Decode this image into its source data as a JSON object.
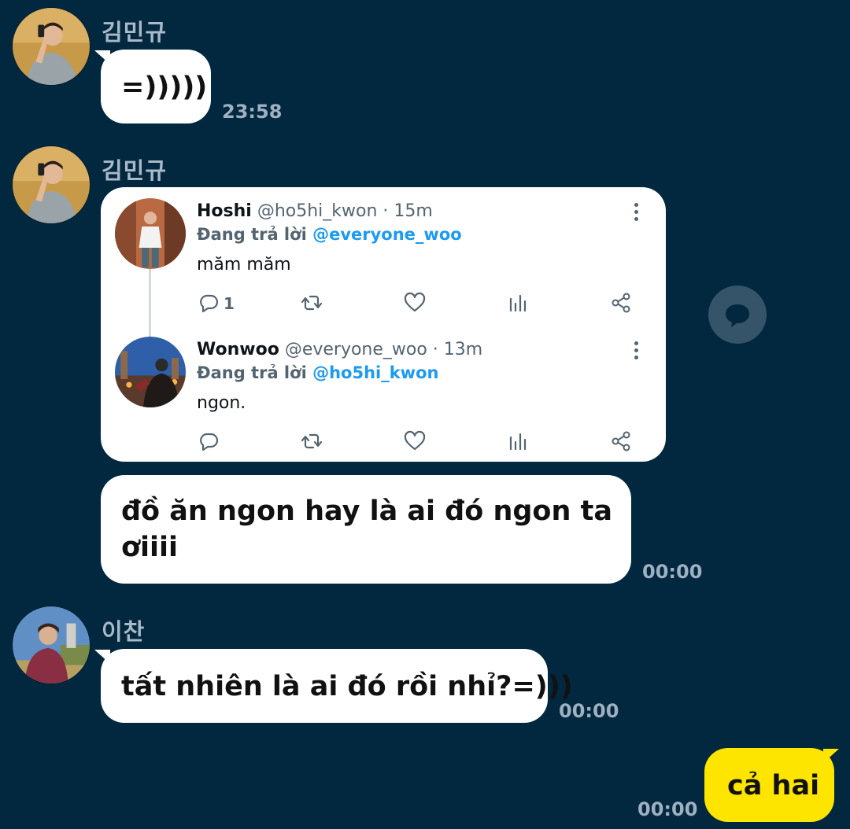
{
  "colors": {
    "background": "#022840",
    "bubble_incoming": "#ffffff",
    "bubble_outgoing": "#fee500",
    "link": "#1d9bf0",
    "name_text": "#a9b9c8",
    "time_text": "#9fb0c0"
  },
  "messages": [
    {
      "sender": "김민규",
      "text": "=)))))",
      "time": "23:58"
    },
    {
      "sender": "김민규",
      "shared_thread": [
        {
          "display_name": "Hoshi",
          "meta": "@ho5hi_kwon · 15m",
          "replying_prefix": "Đang trả lời",
          "replying_to": "@everyone_woo",
          "text": "măm măm",
          "reply_count": "1",
          "icons": [
            "reply-icon",
            "retweet-icon",
            "like-icon",
            "views-icon",
            "share-icon",
            "more-icon"
          ]
        },
        {
          "display_name": "Wonwoo",
          "meta": "@everyone_woo · 13m",
          "replying_prefix": "Đang trả lời",
          "replying_to": "@ho5hi_kwon",
          "text": "ngon.",
          "reply_count": "",
          "icons": [
            "reply-icon",
            "retweet-icon",
            "like-icon",
            "views-icon",
            "share-icon",
            "more-icon"
          ]
        }
      ]
    },
    {
      "sender": "김민규",
      "line1": "đồ ăn ngon hay là ai đó ngon ta",
      "line2": "ơiiii",
      "time": "00:00"
    },
    {
      "sender": "이찬",
      "text": "tất nhiên là ai đó rồi nhỉ?=)))",
      "time": "00:00"
    },
    {
      "sender": "me",
      "text": "cả hai",
      "time": "00:00"
    }
  ]
}
